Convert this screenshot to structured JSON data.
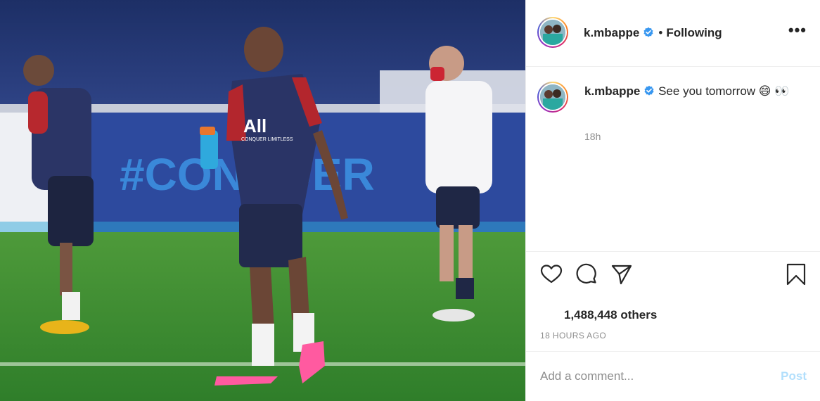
{
  "post": {
    "author": {
      "username": "k.mbappe",
      "verified": true,
      "follow_status": "Following",
      "separator": "•"
    },
    "more_options_label": "•••",
    "caption": {
      "username": "k.mbappe",
      "text": "See you tomorrow 😄 👀",
      "time": "18h"
    },
    "actions": {
      "icons": [
        "heart-icon",
        "comment-icon",
        "share-icon",
        "bookmark-icon"
      ]
    },
    "likes_text": "1,488,448 others",
    "timestamp": "18 HOURS AGO",
    "comment": {
      "placeholder": "Add a comment...",
      "post_label": "Post"
    },
    "photo_overlay": {
      "jersey_logo": "All",
      "jersey_slogan": "CONQUER LIMITLESS",
      "banner_text": "#CONQUER"
    }
  },
  "colors": {
    "text": "#262626",
    "muted": "#8e8e8e",
    "verified": "#3897f0",
    "post_disabled": "#b2dffc",
    "border": "#efefef"
  }
}
